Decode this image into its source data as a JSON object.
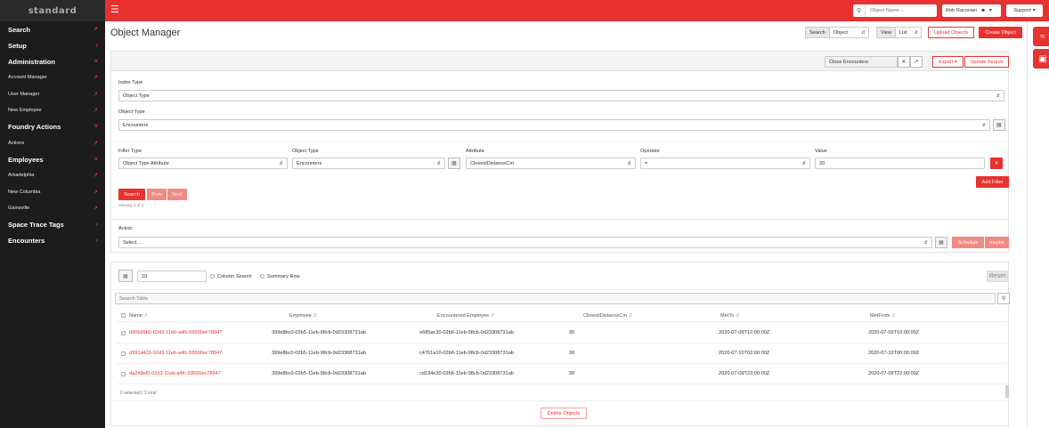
{
  "brand": "standard",
  "sidebar": {
    "items": [
      {
        "label": "Search",
        "type": "section",
        "icon": "link-icon"
      },
      {
        "label": "Setup",
        "type": "section",
        "icon": "chevron-right-icon"
      },
      {
        "label": "Administration",
        "type": "section",
        "icon": "chevron-down-icon"
      },
      {
        "label": "Account Manager",
        "type": "sub",
        "icon": "link-icon"
      },
      {
        "label": "User Manager",
        "type": "sub",
        "icon": "link-icon"
      },
      {
        "label": "New Employee",
        "type": "sub",
        "icon": "link-icon"
      },
      {
        "label": "Foundry Actions",
        "type": "section",
        "icon": "chevron-down-icon"
      },
      {
        "label": "Actions",
        "type": "sub",
        "icon": "link-icon"
      },
      {
        "label": "Employees",
        "type": "section",
        "icon": "chevron-down-icon"
      },
      {
        "label": "Arkadelphia",
        "type": "sub",
        "icon": "link-icon"
      },
      {
        "label": "New Columbia",
        "type": "sub",
        "icon": "link-icon"
      },
      {
        "label": "Gainsville",
        "type": "sub",
        "icon": "link-icon"
      },
      {
        "label": "Space Trace Tags",
        "type": "section",
        "icon": "chevron-right-icon"
      },
      {
        "label": "Encounters",
        "type": "section",
        "icon": "chevron-right-icon"
      }
    ]
  },
  "topbar": {
    "search_placeholder": "Object Name...",
    "user_name": "Rob Racovian",
    "support_label": "Support"
  },
  "page": {
    "title": "Object Manager",
    "search_label": "Search",
    "search_value": "Object",
    "view_label": "View",
    "view_value": "List",
    "upload_label": "Upload Objects",
    "create_label": "Create Object"
  },
  "search_panel": {
    "saved_search": "Close Encounters",
    "export_label": "Export",
    "update_label": "Update Search",
    "index_type_label": "Index Type",
    "index_type_value": "Object Type",
    "object_type_label": "Object Type",
    "object_type_value": "Encounters",
    "filter_type_label": "Filter Type",
    "filter_type_value": "Object Type Attribute",
    "filter_object_type_label": "Object Type",
    "filter_object_type_value": "Encounters",
    "attribute_label": "Attribute",
    "attribute_value": "ClosestDistanceCm",
    "operator_label": "Operator",
    "operator_value": "=",
    "value_label": "Value",
    "value_value": "20",
    "add_filter_label": "Add Filter",
    "search_button": "Search",
    "prev_button": "Prev",
    "next_button": "Next",
    "viewing_text": "Viewing 3 of 3"
  },
  "action_panel": {
    "action_label": "Action",
    "action_value": "Select...",
    "schedule_label": "Schedule",
    "invoke_label": "Invoke"
  },
  "table_panel": {
    "page_size": "10",
    "column_search_label": "Column Search",
    "summary_row_label": "Summary Row",
    "reset_label": "Reset",
    "search_table_placeholder": "Search Table",
    "columns": [
      "Name",
      "Employee",
      "Encountered Employee",
      "ClosestDistanceCm",
      "MetTo",
      "MetFrom"
    ],
    "rows": [
      [
        "d90b99b0-02d3-11eb-a4fc-59500ec78947",
        "399e8bc0-02b5-11eb-98cb-0d23308731ab",
        "e685ac30-02b6-11eb-98cb-0d23308731ab",
        "30",
        "2020-07-09T12:00:00Z",
        "2020-07-09T10:00:00Z"
      ],
      [
        "d991d420-02d3-11eb-a4fc-59500ec78947",
        "399e8bc0-02b5-11eb-98cb-0d23308731ab",
        "c4761a10-02b6-11eb-98cb-0d23308731ab",
        "30",
        "2020-07-10T02:00:00Z",
        "2020-07-10T00:00:00Z"
      ],
      [
        "da2d9ef0-02d3-11eb-a4fc-59500ec78947",
        "399e8bc0-02b5-11eb-98cb-0d23308731ab",
        "cd134e30-02b6-11eb-98cb-0d23308731ab",
        "30",
        "2020-07-09T23:00:00Z",
        "2020-07-09T22:00:00Z"
      ]
    ],
    "footer_text": "0 selected | 3 total",
    "delete_label": "Delete Objects"
  },
  "colors": {
    "accent": "#e8322f",
    "sidebar": "#1c1c1c"
  }
}
